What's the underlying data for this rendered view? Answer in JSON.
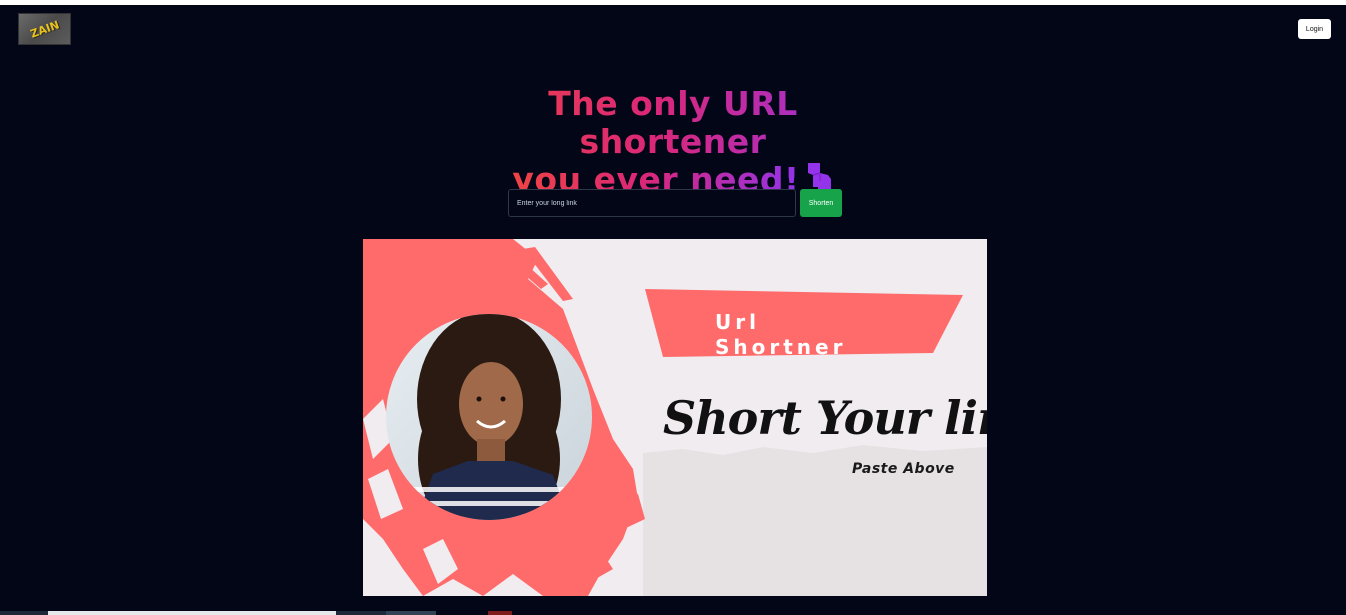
{
  "header": {
    "logo_text": "ZAIN",
    "login_label": "Login"
  },
  "hero": {
    "headline_line1": "The only URL shortener",
    "headline_line2": "you ever need!",
    "hand_icon": "pointing-down-hand-icon"
  },
  "form": {
    "input_placeholder": "Enter your long link",
    "input_value": "",
    "shorten_label": "Shorten"
  },
  "banner": {
    "ribbon_title": "Url\nShortner",
    "script_text": "Short Your link",
    "subtext": "Paste Above",
    "accent_color": "#ff6b6b"
  },
  "colors": {
    "background": "#020617",
    "headline_gradient_start": "#ef4444",
    "headline_gradient_end": "#9333ea",
    "shorten_button": "#16a34a"
  }
}
